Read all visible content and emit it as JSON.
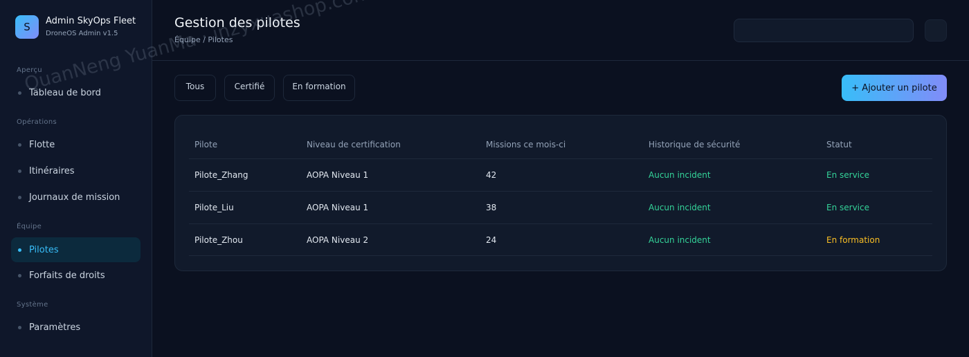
{
  "brand": {
    "logo_letter": "S",
    "name": "Admin SkyOps Fleet",
    "subtitle": "DroneOS Admin v1.5"
  },
  "sidebar": {
    "sections": [
      {
        "label": "Aperçu",
        "items": [
          {
            "label": "Tableau de bord"
          }
        ]
      },
      {
        "label": "Opérations",
        "items": [
          {
            "label": "Flotte"
          },
          {
            "label": "Itinéraires"
          },
          {
            "label": "Journaux de mission"
          }
        ]
      },
      {
        "label": "Équipe",
        "items": [
          {
            "label": "Pilotes",
            "active": true
          },
          {
            "label": "Forfaits de droits"
          }
        ]
      },
      {
        "label": "Système",
        "items": [
          {
            "label": "Paramètres"
          }
        ]
      }
    ]
  },
  "header": {
    "title": "Gestion des pilotes",
    "breadcrumb": "Équipe / Pilotes",
    "search_value": ""
  },
  "filters": [
    {
      "label": "Tous"
    },
    {
      "label": "Certifié"
    },
    {
      "label": "En formation"
    }
  ],
  "actions": {
    "add_label": "+ Ajouter un pilote"
  },
  "table": {
    "columns": [
      "Pilote",
      "Niveau de certification",
      "Missions ce mois-ci",
      "Historique de sécurité",
      "Statut"
    ],
    "rows": [
      {
        "pilot": "Pilote_Zhang",
        "level": "AOPA Niveau 1",
        "missions": "42",
        "safety": "Aucun incident",
        "status": "En service"
      },
      {
        "pilot": "Pilote_Liu",
        "level": "AOPA Niveau 1",
        "missions": "38",
        "safety": "Aucun incident",
        "status": "En service"
      },
      {
        "pilot": "Pilote_Zhou",
        "level": "AOPA Niveau 2",
        "missions": "24",
        "safety": "Aucun incident",
        "status": "En formation"
      }
    ]
  },
  "colors": {
    "accent": "#38bdf8",
    "accent_end": "#818cf8",
    "success": "#34d399",
    "warning": "#fbbf24",
    "background": "#0b1120"
  },
  "watermark": "QuanNeng YuanMa · inzyxuashop.com"
}
